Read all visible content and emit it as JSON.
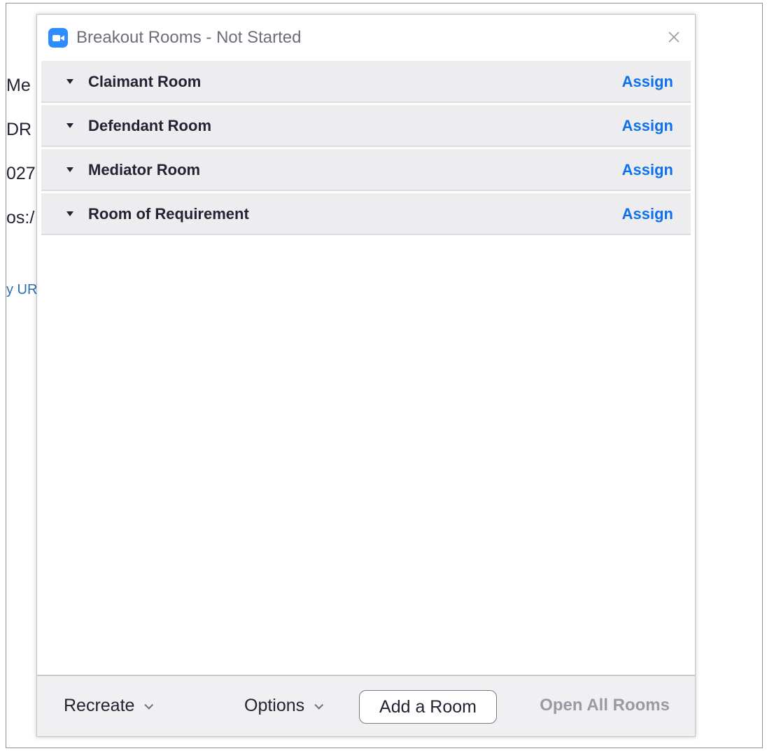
{
  "background_window": {
    "lines": [
      " Me",
      "DR (",
      "027(",
      "os:/",
      "y UR"
    ]
  },
  "dialog": {
    "title": "Breakout Rooms - Not Started",
    "app_icon": "zoom-camera-icon",
    "close_icon": "close-icon"
  },
  "rooms": [
    {
      "name": "Claimant Room",
      "action": "Assign"
    },
    {
      "name": "Defendant Room",
      "action": "Assign"
    },
    {
      "name": "Mediator Room",
      "action": "Assign"
    },
    {
      "name": "Room of Requirement",
      "action": "Assign"
    }
  ],
  "footer": {
    "recreate_label": "Recreate",
    "options_label": "Options",
    "add_room_label": "Add a Room",
    "open_all_label": "Open All Rooms"
  },
  "colors": {
    "accent": "#0e72ed",
    "app_icon": "#2d8cff",
    "disabled_text": "#9a9aa4",
    "row_background": "#ededef"
  }
}
